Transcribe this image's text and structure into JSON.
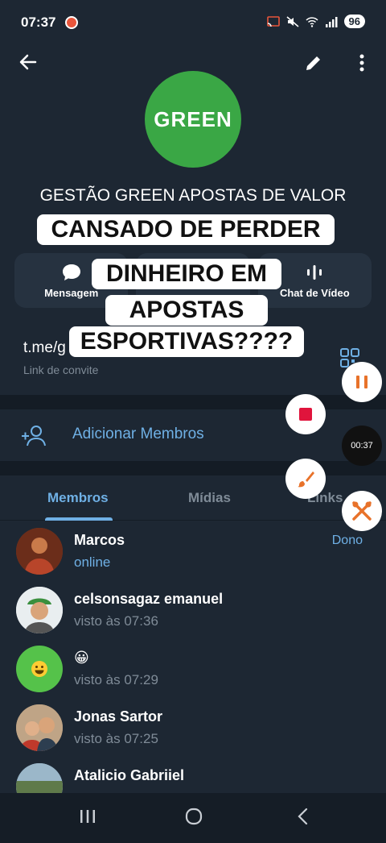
{
  "status": {
    "time": "07:37",
    "battery": "96"
  },
  "group": {
    "avatar_text": "GREEN",
    "name": "GESTÃO GREEN APOSTAS DE VALOR"
  },
  "actions": {
    "message_label": "Mensagem",
    "video_chat_label": "Chat de Vídeo"
  },
  "overlay": {
    "line1": "CANSADO DE PERDER",
    "line2": "DINHEIRO EM",
    "line3": "APOSTAS",
    "line4": "ESPORTIVAS????"
  },
  "link": {
    "value": "t.me/g",
    "subtitle": "Link de convite"
  },
  "add_members_label": "Adicionar Membros",
  "tabs": [
    "Membros",
    "Mídias",
    "Links"
  ],
  "members": [
    {
      "name": "Marcos",
      "status": "online",
      "role": "Dono"
    },
    {
      "name": "celsonsagaz emanuel",
      "status": "visto às 07:36"
    },
    {
      "name": "😀",
      "status": "visto às 07:29"
    },
    {
      "name": "Jonas Sartor",
      "status": "visto às 07:25"
    },
    {
      "name": "Atalicio Gabriiel",
      "status": ""
    }
  ],
  "recorder": {
    "timer": "00:37"
  },
  "colors": {
    "background": "#1d2733",
    "accent": "#6fb0e5",
    "brand_green": "#3aa745",
    "record_red": "#e0143c",
    "tool_orange": "#e8722a"
  }
}
